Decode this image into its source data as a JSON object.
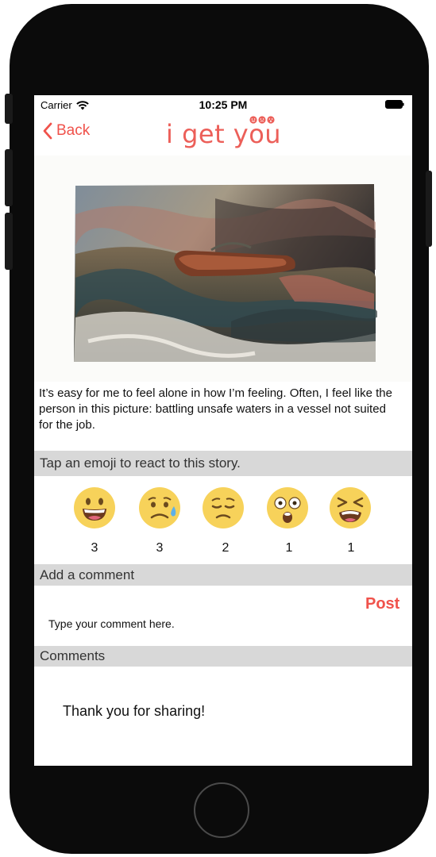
{
  "status_bar": {
    "carrier": "Carrier",
    "time": "10:25 PM"
  },
  "nav": {
    "back_label": "Back",
    "logo_text": "i get you"
  },
  "story": {
    "text": "It’s easy for me to feel alone in how I’m feeling. Often, I feel like the person in this picture: battling unsafe waters in a vessel not suited for the job."
  },
  "reactions": {
    "header": "Tap an emoji to react to this story.",
    "items": [
      {
        "icon": "grinning-face-icon",
        "count": "3"
      },
      {
        "icon": "sad-sweat-face-icon",
        "count": "3"
      },
      {
        "icon": "pensive-face-icon",
        "count": "2"
      },
      {
        "icon": "astonished-face-icon",
        "count": "1"
      },
      {
        "icon": "tired-face-icon",
        "count": "1"
      }
    ]
  },
  "add_comment": {
    "header": "Add a comment",
    "placeholder": "Type your comment here.",
    "post_label": "Post"
  },
  "comments": {
    "header": "Comments",
    "items": [
      "Thank you for sharing!"
    ]
  },
  "colors": {
    "accent": "#f0524b",
    "section_bg": "#d8d8d8",
    "emoji_face": "#f7d25a"
  }
}
